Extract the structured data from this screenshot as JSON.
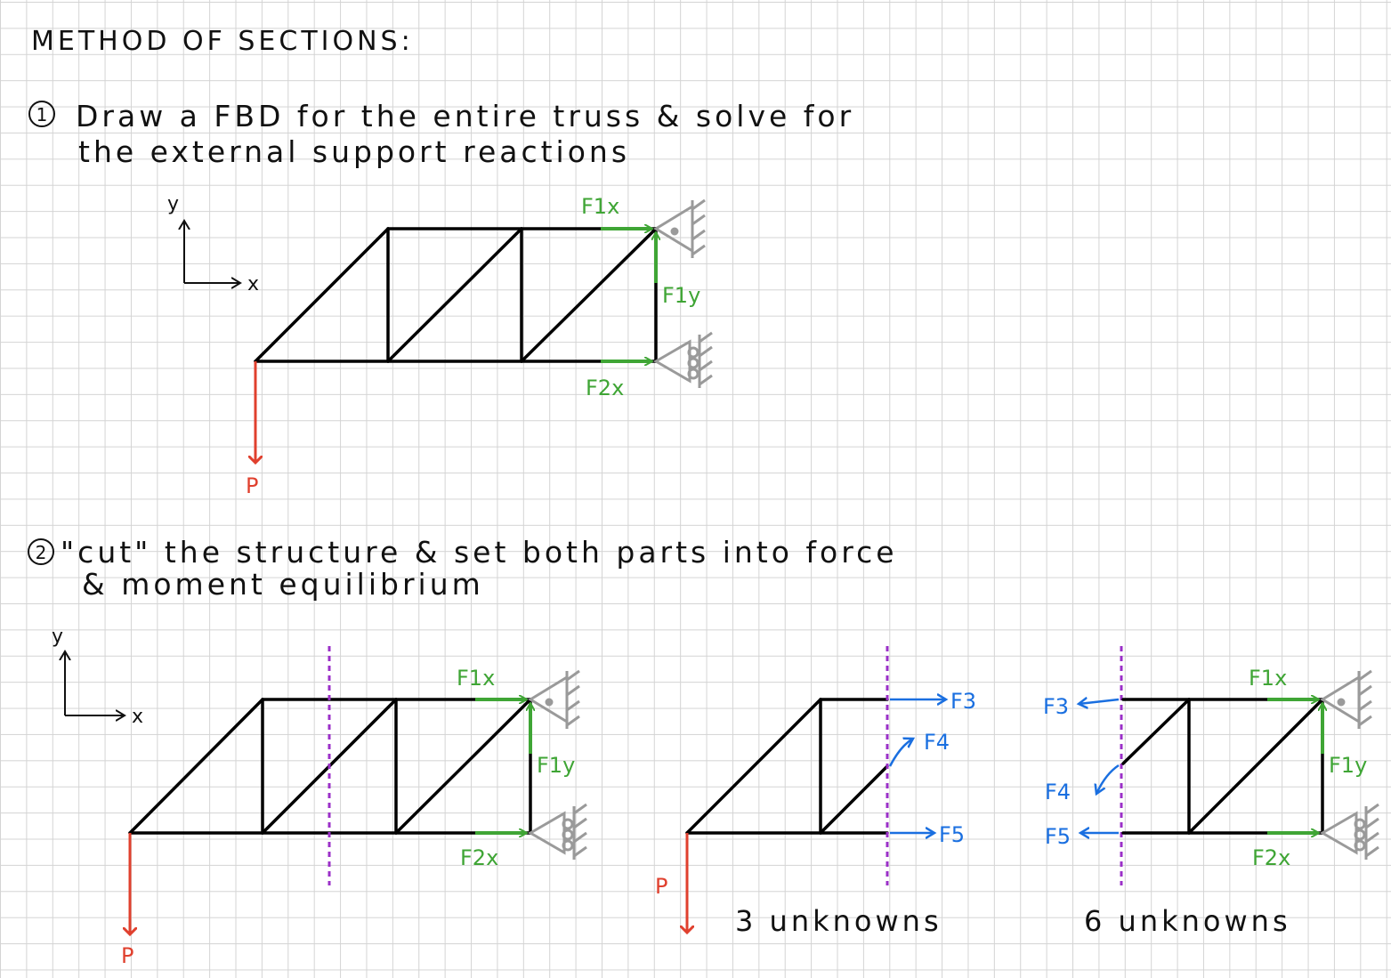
{
  "title": "METHOD OF SECTIONS:",
  "step1": {
    "number": "1",
    "line1": "Draw a FBD for the entire truss & solve for",
    "line2": "the external support reactions"
  },
  "step2": {
    "number": "2",
    "line1": "\"cut\" the structure & set both parts into force",
    "line2": "& moment equilibrium"
  },
  "axes": {
    "y": "y",
    "x": "x"
  },
  "forces": {
    "f1x": "F1x",
    "f1y": "F1y",
    "f2x": "F2x",
    "p": "P",
    "f3": "F3",
    "f4": "F4",
    "f5": "F5"
  },
  "unknowns_left": "3 unknowns",
  "unknowns_right": "6 unknowns",
  "colors": {
    "member": "#000000",
    "reaction": "#3fa535",
    "load": "#e0402e",
    "internal": "#1a6fe0",
    "cut": "#9b30c8",
    "support": "#9a9a9a",
    "grid": "#d4d4d4"
  }
}
